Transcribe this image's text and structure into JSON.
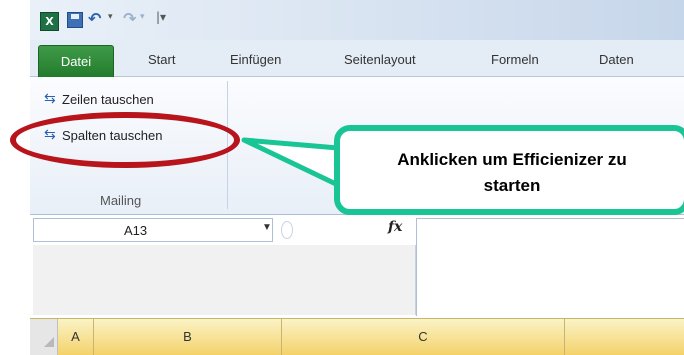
{
  "quick_access": {
    "app_icon": "X",
    "icons": [
      "excel-logo-icon",
      "save-icon",
      "undo-icon",
      "redo-icon",
      "customize-icon"
    ]
  },
  "tabs": {
    "file": "Datei",
    "items": [
      "Start",
      "Einfügen",
      "Seitenlayout",
      "Formeln",
      "Daten"
    ]
  },
  "ribbon": {
    "commands": [
      "Zeilen tauschen",
      "Spalten tauschen"
    ],
    "group_label": "Mailing"
  },
  "annotation": {
    "callout_line1": "Anklicken um Efficienizer zu",
    "callout_line2": "starten",
    "oval_color": "#b8141b",
    "callout_border_color": "#19c594"
  },
  "formula_bar": {
    "namebox_value": "A13",
    "fx_label": "fx"
  },
  "columns": [
    "A",
    "B",
    "C"
  ],
  "colors": {
    "file_tab": "#2e8b3a",
    "header_highlight": "#f3d26a"
  }
}
